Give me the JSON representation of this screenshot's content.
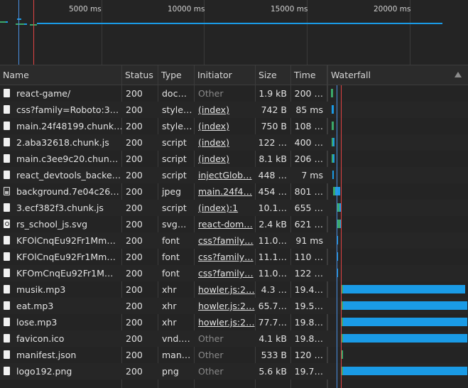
{
  "overview": {
    "ticks": [
      "5000 ms",
      "10000 ms",
      "15000 ms",
      "20000 ms"
    ]
  },
  "columns": {
    "name": "Name",
    "status": "Status",
    "type": "Type",
    "initiator": "Initiator",
    "size": "Size",
    "time": "Time",
    "waterfall": "Waterfall"
  },
  "colors": {
    "waiting": "#3ba86a",
    "download": "#1a9be6",
    "dom_loaded_line": "#4a90e2",
    "load_line": "#e04343"
  },
  "requests": [
    {
      "name": "react-game/",
      "status": "200",
      "type": "doc…",
      "initiator": "Other",
      "initiator_kind": "muted",
      "size": "1.9 kB",
      "time": "200 …",
      "icon": "document-icon"
    },
    {
      "name": "css?family=Roboto:3…",
      "status": "200",
      "type": "style…",
      "initiator": "(index)",
      "initiator_kind": "link",
      "size": "742 B",
      "time": "85 ms",
      "icon": "document-icon"
    },
    {
      "name": "main.24f48199.chunk…",
      "status": "200",
      "type": "style…",
      "initiator": "(index)",
      "initiator_kind": "link",
      "size": "750 B",
      "time": "108 …",
      "icon": "document-icon"
    },
    {
      "name": "2.aba32618.chunk.js",
      "status": "200",
      "type": "script",
      "initiator": "(index)",
      "initiator_kind": "link",
      "size": "122 …",
      "time": "400 …",
      "icon": "document-icon"
    },
    {
      "name": "main.c3ee9c20.chun…",
      "status": "200",
      "type": "script",
      "initiator": "(index)",
      "initiator_kind": "link",
      "size": "8.1 kB",
      "time": "206 …",
      "icon": "document-icon"
    },
    {
      "name": "react_devtools_backe…",
      "status": "200",
      "type": "script",
      "initiator": "injectGlob…",
      "initiator_kind": "link",
      "size": "448 …",
      "time": "7 ms",
      "icon": "document-icon"
    },
    {
      "name": "background.7e04c26…",
      "status": "200",
      "type": "jpeg",
      "initiator": "main.24f4…",
      "initiator_kind": "link",
      "size": "454 …",
      "time": "801 …",
      "icon": "image-icon"
    },
    {
      "name": "3.ecf382f3.chunk.js",
      "status": "200",
      "type": "script",
      "initiator": "(index):1",
      "initiator_kind": "link",
      "size": "10.1…",
      "time": "655 …",
      "icon": "document-icon"
    },
    {
      "name": "rs_school_js.svg",
      "status": "200",
      "type": "svg…",
      "initiator": "react-dom…",
      "initiator_kind": "link",
      "size": "2.4 kB",
      "time": "621 …",
      "icon": "svg-icon"
    },
    {
      "name": "KFOlCnqEu92Fr1Mm…",
      "status": "200",
      "type": "font",
      "initiator": "css?family…",
      "initiator_kind": "link",
      "size": "11.0…",
      "time": "91 ms",
      "icon": "document-icon"
    },
    {
      "name": "KFOlCnqEu92Fr1Mm…",
      "status": "200",
      "type": "font",
      "initiator": "css?family…",
      "initiator_kind": "link",
      "size": "11.1…",
      "time": "110 …",
      "icon": "document-icon"
    },
    {
      "name": "KFOmCnqEu92Fr1M…",
      "status": "200",
      "type": "font",
      "initiator": "css?family…",
      "initiator_kind": "link",
      "size": "11.0…",
      "time": "122 …",
      "icon": "document-icon"
    },
    {
      "name": "musik.mp3",
      "status": "200",
      "type": "xhr",
      "initiator": "howler.js:2…",
      "initiator_kind": "link",
      "size": "4.3 …",
      "time": "19.4…",
      "icon": "document-icon"
    },
    {
      "name": "eat.mp3",
      "status": "200",
      "type": "xhr",
      "initiator": "howler.js:2…",
      "initiator_kind": "link",
      "size": "65.7…",
      "time": "19.5…",
      "icon": "document-icon"
    },
    {
      "name": "lose.mp3",
      "status": "200",
      "type": "xhr",
      "initiator": "howler.js:2…",
      "initiator_kind": "link",
      "size": "77.7…",
      "time": "19.8…",
      "icon": "document-icon"
    },
    {
      "name": "favicon.ico",
      "status": "200",
      "type": "vnd.…",
      "initiator": "Other",
      "initiator_kind": "muted",
      "size": "4.1 kB",
      "time": "19.8…",
      "icon": "document-icon"
    },
    {
      "name": "manifest.json",
      "status": "200",
      "type": "man…",
      "initiator": "Other",
      "initiator_kind": "muted",
      "size": "533 B",
      "time": "120 …",
      "icon": "document-icon"
    },
    {
      "name": "logo192.png",
      "status": "200",
      "type": "png",
      "initiator": "Other",
      "initiator_kind": "muted",
      "size": "5.6 kB",
      "time": "19.7…",
      "icon": "document-icon"
    }
  ]
}
